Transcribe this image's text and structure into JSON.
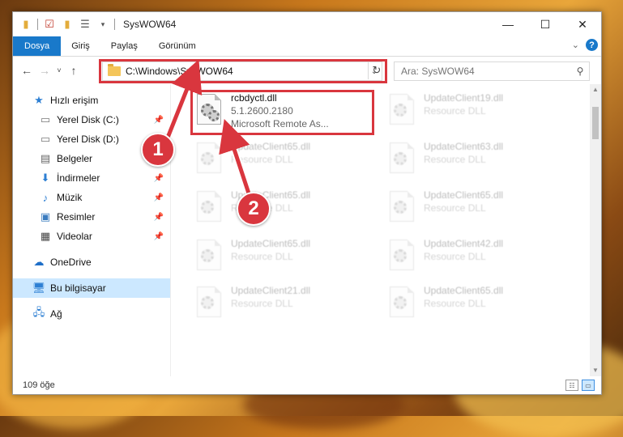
{
  "window": {
    "title": "SysWOW64",
    "controls": {
      "minimize": "—",
      "maximize": "☐",
      "close": "✕"
    }
  },
  "ribbon": {
    "tabs": [
      "Dosya",
      "Giriş",
      "Paylaş",
      "Görünüm"
    ],
    "expand_icon": "chevron-down-icon",
    "help_label": "?"
  },
  "navigation": {
    "address_path": "C:\\Windows\\SysWOW64",
    "search_placeholder": "Ara: SysWOW64"
  },
  "sidebar": {
    "items": [
      {
        "label": "Hızlı erişim",
        "icon": "star-icon",
        "pinned": false
      },
      {
        "label": "Yerel Disk (C:)",
        "icon": "disk-icon",
        "pinned": true
      },
      {
        "label": "Yerel Disk (D:)",
        "icon": "disk-icon",
        "pinned": false
      },
      {
        "label": "Belgeler",
        "icon": "document-icon",
        "pinned": false
      },
      {
        "label": "İndirmeler",
        "icon": "download-icon",
        "pinned": true
      },
      {
        "label": "Müzik",
        "icon": "music-icon",
        "pinned": true
      },
      {
        "label": "Resimler",
        "icon": "pictures-icon",
        "pinned": true
      },
      {
        "label": "Videolar",
        "icon": "video-icon",
        "pinned": true
      },
      {
        "label": "OneDrive",
        "icon": "cloud-icon",
        "pinned": false
      },
      {
        "label": "Bu bilgisayar",
        "icon": "computer-icon",
        "pinned": false,
        "selected": true
      },
      {
        "label": "Ağ",
        "icon": "network-icon",
        "pinned": false
      }
    ]
  },
  "files": {
    "highlighted": {
      "name": "rcbdyctl.dll",
      "version": "5.1.2600.2180",
      "description": "Microsoft Remote As..."
    },
    "faded": [
      {
        "name": "UpdateClient19.dll",
        "type": "Resource DLL"
      },
      {
        "name": "UpdateClient65.dll",
        "type": "Resource DLL"
      },
      {
        "name": "UpdateClient63.dll",
        "type": "Resource DLL"
      },
      {
        "name": "UpdateClient65.dll",
        "type": "Resource DLL"
      },
      {
        "name": "UpdateClient65.dll",
        "type": "Resource DLL"
      },
      {
        "name": "UpdateClient65.dll",
        "type": "Resource DLL"
      },
      {
        "name": "UpdateClient42.dll",
        "type": "Resource DLL"
      },
      {
        "name": "UpdateClient21.dll",
        "type": "Resource DLL"
      },
      {
        "name": "UpdateClient65.dll",
        "type": "Resource DLL"
      }
    ]
  },
  "status": {
    "item_count": "109 öğe"
  },
  "callouts": {
    "step1": "1",
    "step2": "2",
    "accent_color": "#d9363e"
  }
}
